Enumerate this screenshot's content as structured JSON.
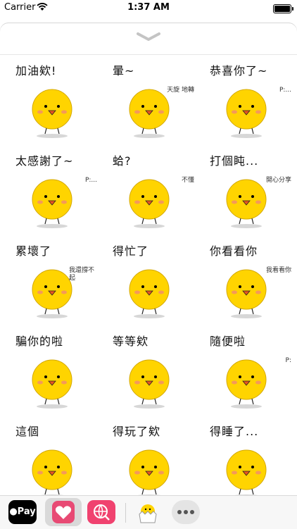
{
  "status_bar": {
    "carrier": "Carrier",
    "time": "1:37 AM"
  },
  "stickers": [
    {
      "caption": "加油欸!",
      "extra": ""
    },
    {
      "caption": "暈~",
      "extra": "天旋 地轉"
    },
    {
      "caption": "恭喜你了~",
      "extra": "P:..."
    },
    {
      "caption": "太感謝了~",
      "extra": "P:..."
    },
    {
      "caption": "蛤?",
      "extra": "不懂"
    },
    {
      "caption": "打個盹...",
      "extra": "開心分享"
    },
    {
      "caption": "累壞了",
      "extra": "我還撐不起"
    },
    {
      "caption": "得忙了",
      "extra": ""
    },
    {
      "caption": "你看看你",
      "extra": "我看看你"
    },
    {
      "caption": "騙你的啦",
      "extra": ""
    },
    {
      "caption": "等等欸",
      "extra": ""
    },
    {
      "caption": "隨便啦",
      "extra": "P:"
    },
    {
      "caption": "這個",
      "extra": ""
    },
    {
      "caption": "得玩了欸",
      "extra": ""
    },
    {
      "caption": "得睡了...",
      "extra": ""
    }
  ],
  "drawer": {
    "applepay_label": "Pay",
    "apps": [
      "apple-pay",
      "heart-stickers",
      "search-stickers",
      "chick-stickers",
      "more"
    ]
  },
  "colors": {
    "chick_yellow": "#FFD400",
    "beak": "#E8541F",
    "blush": "#F08080",
    "accent_pink": "#E84A74"
  }
}
